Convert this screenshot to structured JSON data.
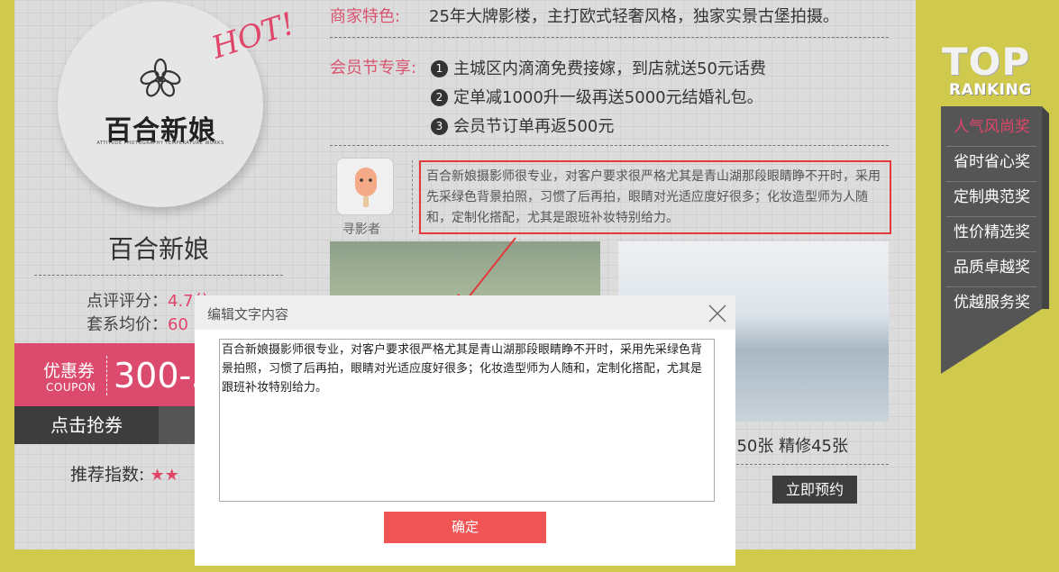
{
  "shop": {
    "logo_text": "百合新娘",
    "logo_sub": "ATTITUDE PHOTOGRAPHY TEMPERATURE WORKS",
    "hot": "HOT!",
    "name": "百合新娘",
    "score_label": "点评评分：",
    "score_value": "4.7分",
    "price_label": "套系均价：",
    "price_value": "60",
    "coupon_label": "优惠券",
    "coupon_en": "COUPON",
    "coupon_amount": "300-5",
    "grab_label": "点击抢券",
    "recommend_label": "推荐指数:",
    "recommend_stars": "★★"
  },
  "features": {
    "label": "商家特色:",
    "text": "25年大牌影楼，主打欧式轻奢风格，独家实景古堡拍摄。"
  },
  "member": {
    "label": "会员节专享:",
    "items": [
      {
        "num": "1",
        "text": "主城区内滴滴免费接嫁，到店就送50元话费"
      },
      {
        "num": "2",
        "text": "定单减1000升一级再送5000元结婚礼包。"
      },
      {
        "num": "3",
        "text": "会员节订单再返500元"
      }
    ]
  },
  "review": {
    "reviewer": "寻影者",
    "text": "百合新娘摄影师很专业，对客户要求很严格尤其是青山湖那段眼睛睁不开时，采用先采绿色背景拍照，习惯了后再拍，眼睛对光适应度好很多；化妆造型师为人随和，定制化搭配，尤其是跟班补妆特别给力。"
  },
  "package": {
    "caption": "摄150张 精修45张",
    "book_label": "立即预约"
  },
  "ranking": {
    "top": "TOP",
    "ranking": "RANKING",
    "items": [
      "人气风尚奖",
      "省时省心奖",
      "定制典范奖",
      "性价精选奖",
      "品质卓越奖",
      "优越服务奖"
    ],
    "active_index": 0
  },
  "modal": {
    "title": "编辑文字内容",
    "content": "百合新娘摄影师很专业，对客户要求很严格尤其是青山湖那段眼睛睁不开时，采用先采绿色背景拍照，习惯了后再拍，眼睛对光适应度好很多；化妆造型师为人随和，定制化搭配，尤其是跟班补妆特别给力。",
    "confirm_label": "确定"
  },
  "colors": {
    "page_bg": "#cfca4e",
    "accent_pink": "#dc4b6e",
    "highlight_red": "#e23a3a",
    "confirm_red": "#f05454",
    "dark_button": "#3d3d3d"
  }
}
